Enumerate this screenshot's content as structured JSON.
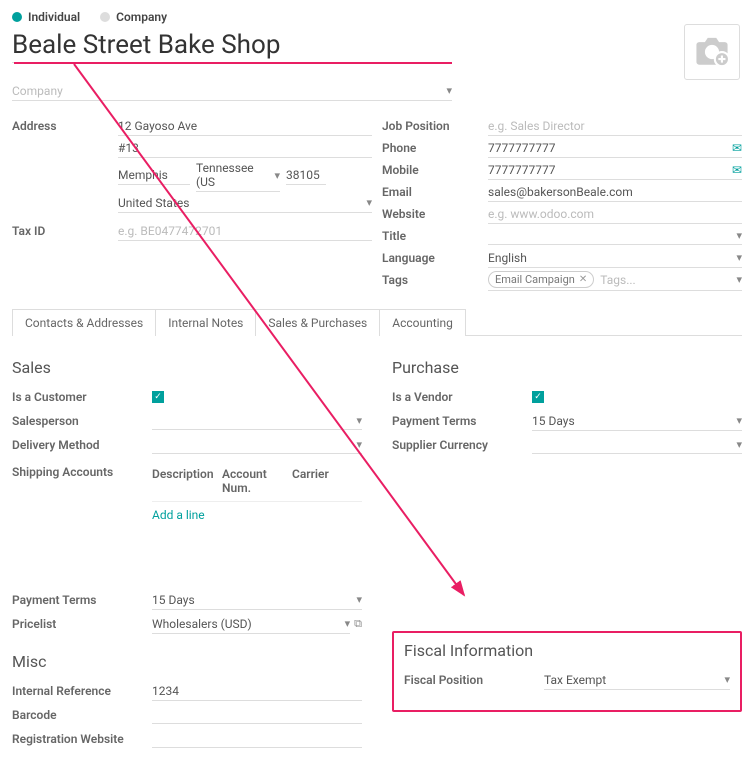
{
  "type": {
    "individual": "Individual",
    "company": "Company",
    "selected": "individual"
  },
  "name": "Beale Street Bake Shop",
  "company_placeholder": "Company",
  "left": {
    "address_label": "Address",
    "street": "12 Gayoso Ave",
    "street2": "#13",
    "city": "Memphis",
    "state": "Tennessee (US",
    "zip": "38105",
    "country": "United States",
    "taxid_label": "Tax ID",
    "taxid_placeholder": "e.g. BE0477472701"
  },
  "right": {
    "job_label": "Job Position",
    "job_placeholder": "e.g. Sales Director",
    "phone_label": "Phone",
    "phone": "7777777777",
    "mobile_label": "Mobile",
    "mobile": "7777777777",
    "email_label": "Email",
    "email": "sales@bakersonBeale.com",
    "website_label": "Website",
    "website_placeholder": "e.g. www.odoo.com",
    "title_label": "Title",
    "language_label": "Language",
    "language": "English",
    "tags_label": "Tags",
    "tag": "Email Campaign",
    "tags_placeholder": "Tags..."
  },
  "tabs": {
    "a": "Contacts & Addresses",
    "b": "Internal Notes",
    "c": "Sales & Purchases",
    "d": "Accounting",
    "active": "c"
  },
  "sales": {
    "heading": "Sales",
    "is_customer_label": "Is a Customer",
    "salesperson_label": "Salesperson",
    "delivery_label": "Delivery Method",
    "shipping_label": "Shipping Accounts",
    "cols": {
      "desc": "Description",
      "acct": "Account Num.",
      "carrier": "Carrier"
    },
    "addline": "Add a line",
    "payment_terms_label": "Payment Terms",
    "payment_terms": "15 Days",
    "pricelist_label": "Pricelist",
    "pricelist": "Wholesalers (USD)"
  },
  "purchase": {
    "heading": "Purchase",
    "is_vendor_label": "Is a Vendor",
    "payment_terms_label": "Payment Terms",
    "payment_terms": "15 Days",
    "supplier_currency_label": "Supplier Currency"
  },
  "misc": {
    "heading": "Misc",
    "internal_ref_label": "Internal Reference",
    "internal_ref": "1234",
    "barcode_label": "Barcode",
    "reg_website_label": "Registration Website"
  },
  "fiscal": {
    "heading": "Fiscal Information",
    "position_label": "Fiscal Position",
    "position": "Tax Exempt"
  }
}
